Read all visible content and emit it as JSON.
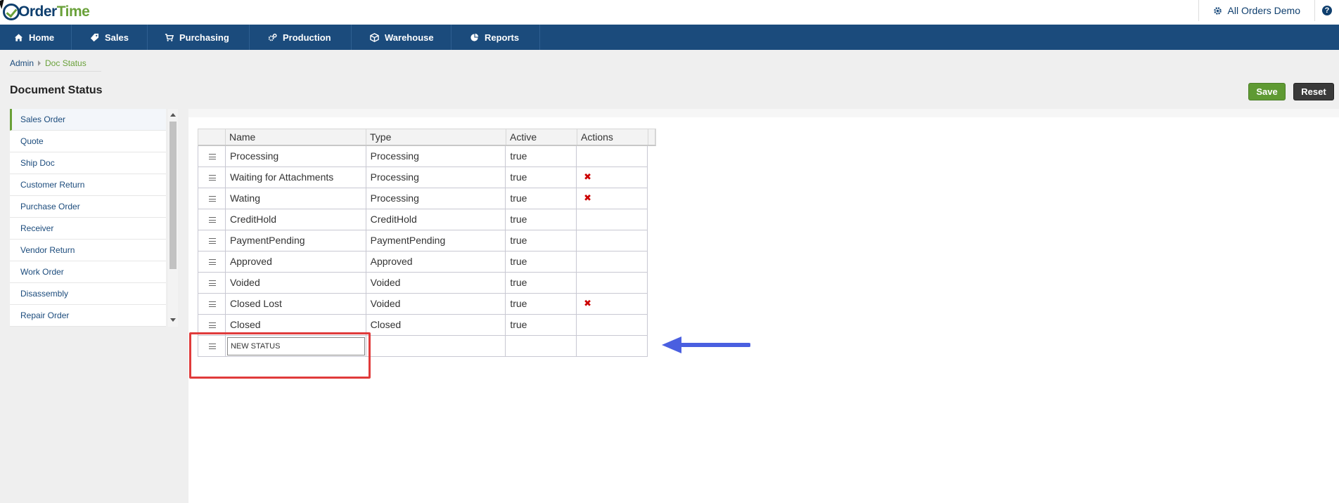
{
  "app": {
    "logo_part1": "Order",
    "logo_part2": "Time",
    "company": "All Orders Demo",
    "help": "?"
  },
  "nav": [
    "Home",
    "Sales",
    "Purchasing",
    "Production",
    "Warehouse",
    "Reports"
  ],
  "breadcrumb": [
    "Admin",
    "Doc Status"
  ],
  "page": {
    "title": "Document Status",
    "save": "Save",
    "reset": "Reset"
  },
  "sidebar": [
    "Sales Order",
    "Quote",
    "Ship Doc",
    "Customer Return",
    "Purchase Order",
    "Receiver",
    "Vendor Return",
    "Work Order",
    "Disassembly",
    "Repair Order"
  ],
  "grid": {
    "headers": [
      "Name",
      "Type",
      "Active",
      "Actions"
    ],
    "rows": [
      {
        "name": "Processing",
        "type": "Processing",
        "active": "true",
        "deletable": false
      },
      {
        "name": "Waiting for Attachments",
        "type": "Processing",
        "active": "true",
        "deletable": true
      },
      {
        "name": "Wating",
        "type": "Processing",
        "active": "true",
        "deletable": true
      },
      {
        "name": "CreditHold",
        "type": "CreditHold",
        "active": "true",
        "deletable": false
      },
      {
        "name": "PaymentPending",
        "type": "PaymentPending",
        "active": "true",
        "deletable": false
      },
      {
        "name": "Approved",
        "type": "Approved",
        "active": "true",
        "deletable": false
      },
      {
        "name": "Voided",
        "type": "Voided",
        "active": "true",
        "deletable": false
      },
      {
        "name": "Closed Lost",
        "type": "Voided",
        "active": "true",
        "deletable": true
      },
      {
        "name": "Closed",
        "type": "Closed",
        "active": "true",
        "deletable": false
      }
    ],
    "new_row": {
      "name_value": "NEW STATUS"
    }
  },
  "colors": {
    "nav_bg": "#1b4b7c",
    "accent_green": "#5f9a33",
    "delete_red": "#cc0000",
    "highlight_red": "#e03b3b",
    "arrow_blue": "#4a5fe0"
  },
  "icons": {
    "delete": "delete-x-icon",
    "drag": "drag-handle-icon"
  }
}
